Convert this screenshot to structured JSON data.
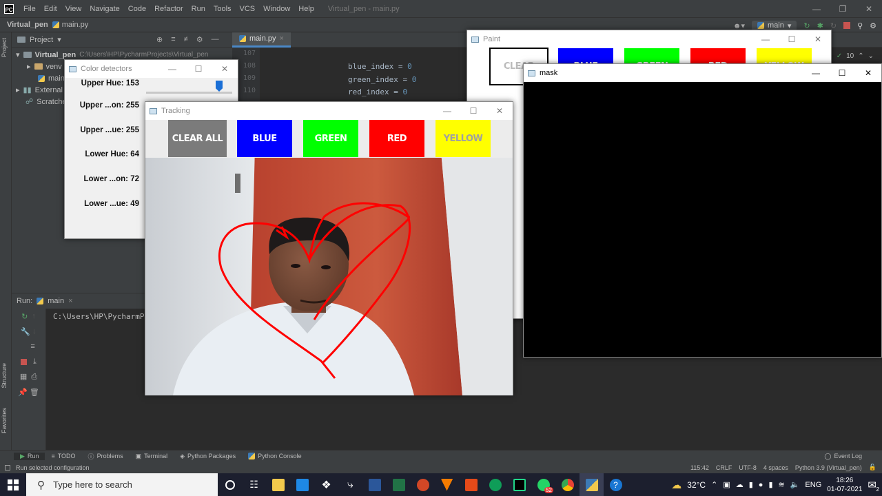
{
  "ide": {
    "menu": [
      "File",
      "Edit",
      "View",
      "Navigate",
      "Code",
      "Refactor",
      "Run",
      "Tools",
      "VCS",
      "Window",
      "Help"
    ],
    "window_title": "Virtual_pen - main.py",
    "breadcrumb_project": "Virtual_pen",
    "breadcrumb_file": "main.py",
    "branch": "main",
    "project_label": "Project",
    "tree": {
      "root": "Virtual_pen",
      "root_path": "C:\\Users\\HP\\PycharmProjects\\Virtual_pen",
      "venv": "venv",
      "main": "main.",
      "external": "External",
      "scratches": "Scratches"
    },
    "editor_tab": "main.py",
    "gutter": [
      "107",
      "108",
      "109",
      "110"
    ],
    "code": [
      {
        "ident": "blue_index = ",
        "val": "0"
      },
      {
        "ident": "green_index = ",
        "val": "0"
      },
      {
        "ident": "red_index = ",
        "val": "0"
      }
    ],
    "warnings": "10",
    "run_label": "Run:",
    "run_config": "main",
    "console_line": "C:\\Users\\HP\\PycharmP",
    "left_strip": {
      "project": "Project",
      "structure": "Structure",
      "favorites": "Favorites"
    },
    "bottom_tabs": [
      "Run",
      "TODO",
      "Problems",
      "Terminal",
      "Python Packages",
      "Python Console"
    ],
    "event_log": "Event Log",
    "status_left": "Run selected configuration",
    "status_right": [
      "115:42",
      "CRLF",
      "UTF-8",
      "4 spaces",
      "Python 3.9 (Virtual_pen)"
    ]
  },
  "color_detectors": {
    "title": "Color detectors",
    "labels": [
      "Upper Hue: 153",
      "Upper ...on: 255",
      "Upper ...ue: 255",
      "Lower Hue: 64",
      "Lower ...on: 72",
      "Lower ...ue: 49"
    ],
    "upper_hue_fraction": 0.85
  },
  "tracking": {
    "title": "Tracking",
    "buttons": [
      {
        "label": "CLEAR ALL",
        "bg": "#7b7b7b",
        "fg": "#ffffff"
      },
      {
        "label": "BLUE",
        "bg": "#0000ff",
        "fg": "#ffffff"
      },
      {
        "label": "GREEN",
        "bg": "#00ff00",
        "fg": "#ffffff"
      },
      {
        "label": "RED",
        "bg": "#ff0000",
        "fg": "#ffffff"
      },
      {
        "label": "YELLOW",
        "bg": "#ffff00",
        "fg": "#a0a0a0"
      }
    ],
    "stroke_color": "#ff0000"
  },
  "paint": {
    "title": "Paint",
    "buttons": [
      {
        "label": "CLEAR",
        "bg": "#ffffff",
        "fg": "#000000"
      },
      {
        "label": "BLUE",
        "bg": "#0000ff",
        "fg": "#ffffff"
      },
      {
        "label": "GREEN",
        "bg": "#00ff00",
        "fg": "#ffffff"
      },
      {
        "label": "RED",
        "bg": "#ff0000",
        "fg": "#ffffff"
      },
      {
        "label": "YELLOW",
        "bg": "#ffff00",
        "fg": "#ffffff"
      }
    ]
  },
  "mask": {
    "title": "mask"
  },
  "taskbar": {
    "search_placeholder": "Type here to search",
    "badge_count": "52",
    "weather": "32°C",
    "language": "ENG",
    "time": "18:26",
    "date": "01-07-2021",
    "notifications": "2"
  }
}
